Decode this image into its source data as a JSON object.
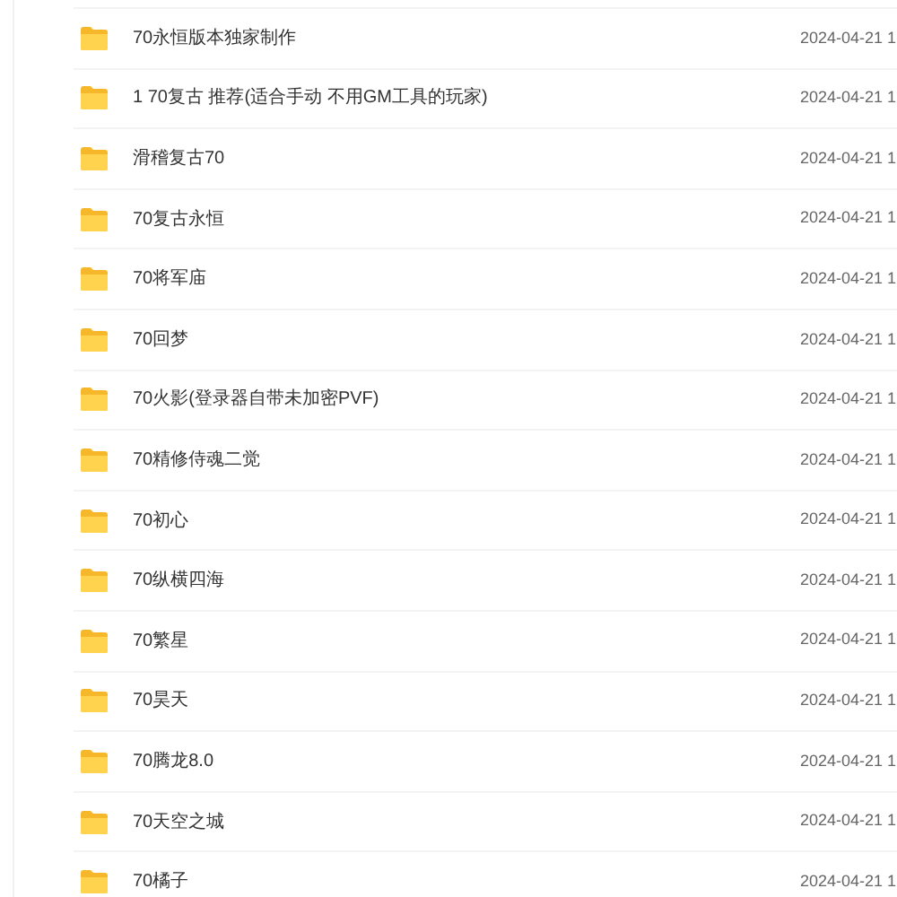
{
  "files": [
    {
      "name": "70永恒版本独家制作",
      "date": "2024-04-21 1"
    },
    {
      "name": "1 70复古 推荐(适合手动 不用GM工具的玩家)",
      "date": "2024-04-21 1"
    },
    {
      "name": "滑稽复古70",
      "date": "2024-04-21 1"
    },
    {
      "name": "70复古永恒",
      "date": "2024-04-21 1"
    },
    {
      "name": "70将军庙",
      "date": "2024-04-21 1"
    },
    {
      "name": "70回梦",
      "date": "2024-04-21 1"
    },
    {
      "name": "70火影(登录器自带未加密PVF)",
      "date": "2024-04-21 1"
    },
    {
      "name": "70精修侍魂二觉",
      "date": "2024-04-21 1"
    },
    {
      "name": "70初心",
      "date": "2024-04-21 1"
    },
    {
      "name": "70纵横四海",
      "date": "2024-04-21 1"
    },
    {
      "name": "70繁星",
      "date": "2024-04-21 1"
    },
    {
      "name": "70昊天",
      "date": "2024-04-21 1"
    },
    {
      "name": "70腾龙8.0",
      "date": "2024-04-21 1"
    },
    {
      "name": "70天空之城",
      "date": "2024-04-21 1"
    },
    {
      "name": "70橘子",
      "date": "2024-04-21 1"
    }
  ]
}
